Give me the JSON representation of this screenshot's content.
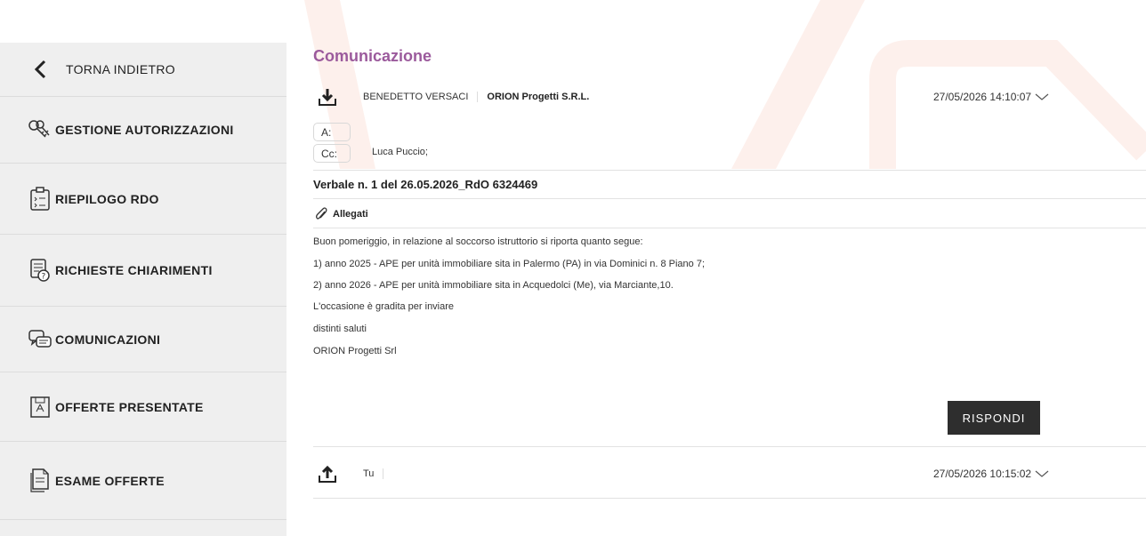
{
  "sidebar": {
    "back": {
      "label": "TORNA INDIETRO",
      "icon": "chevron-left-icon"
    },
    "items": [
      {
        "label": "GESTIONE AUTORIZZAZIONI",
        "icon": "keys-icon"
      },
      {
        "label": "RIEPILOGO RDO",
        "icon": "clipboard-list-icon"
      },
      {
        "label": "RICHIESTE CHIARIMENTI",
        "icon": "document-question-icon"
      },
      {
        "label": "COMUNICAZIONI",
        "icon": "chat-bubbles-icon"
      },
      {
        "label": "OFFERTE PRESENTATE",
        "icon": "offer-document-icon"
      },
      {
        "label": "ESAME OFFERTE",
        "icon": "document-stack-icon"
      }
    ]
  },
  "main": {
    "title": "Comunicazione",
    "message": {
      "sender": "BENEDETTO VERSACI",
      "organization": "ORION Progetti S.R.L.",
      "date": "27/05/2026 14:10:07",
      "to_label": "A:",
      "cc_label": "Cc:",
      "cc_value": "Luca Puccio;",
      "subject": "Verbale n. 1 del 26.05.2026_RdO 6324469",
      "attachments_label": "Allegati",
      "body": [
        "Buon pomeriggio, in relazione al soccorso istruttorio si riporta quanto segue:",
        "1) anno 2025 - APE per unità immobiliare sita in Palermo (PA) in via Dominici n. 8 Piano 7;",
        "2) anno 2026 - APE per unità immobiliare sita in Acquedolci (Me), via Marciante,10.",
        "L'occasione è gradita per inviare",
        "distinti saluti",
        "ORION Progetti Srl"
      ],
      "reply_label": "RISPONDI"
    },
    "sent_message": {
      "sender": "Tu",
      "date": "27/05/2026 10:15:02"
    }
  },
  "colors": {
    "title": "#9b5a9c",
    "sidebar_bg": "#efefef",
    "button_bg": "#2e2e2e",
    "watermark": "#fdece8"
  }
}
